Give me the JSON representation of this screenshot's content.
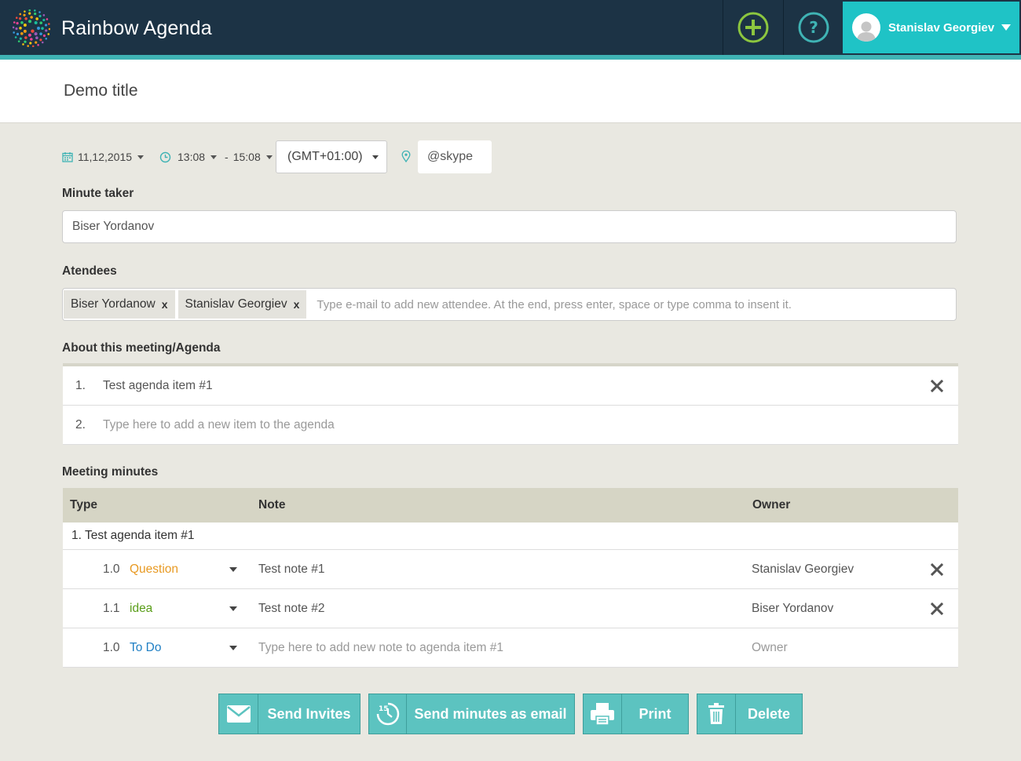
{
  "header": {
    "app_name": "Rainbow Agenda",
    "user_name": "Stanislav Georgiev"
  },
  "page": {
    "title": "Demo title"
  },
  "meta": {
    "date": "11,12,2015",
    "time_start": "13:08",
    "time_sep": "-",
    "time_end": "15:08",
    "timezone": "(GMT+01:00)",
    "location": "@skype"
  },
  "minute_taker": {
    "label": "Minute taker",
    "value": "Biser Yordanov"
  },
  "attendees": {
    "label": "Atendees",
    "chips": [
      "Biser Yordanow",
      "Stanislav Georgiev"
    ],
    "remove_glyph": "x",
    "placeholder": "Type e-mail to add new attendee. At the end, press enter, space or type comma to insent it."
  },
  "agenda": {
    "label": "About this meeting/Agenda",
    "items": [
      {
        "num": "1.",
        "text": "Test agenda item #1"
      }
    ],
    "new_item": {
      "num": "2.",
      "placeholder": "Type here to add a new item to the agenda"
    }
  },
  "minutes": {
    "label": "Meeting minutes",
    "columns": {
      "type": "Type",
      "note": "Note",
      "owner": "Owner"
    },
    "group_title": "1. Test agenda item #1",
    "rows": [
      {
        "num": "1.0",
        "type": "Question",
        "type_color": "#e89a23",
        "note": "Test note #1",
        "owner": "Stanislav Georgiev"
      },
      {
        "num": "1.1",
        "type": "idea",
        "type_color": "#5a9e1a",
        "note": "Test note #2",
        "owner": "Biser Yordanov"
      }
    ],
    "new_row": {
      "num": "1.0",
      "type": "To Do",
      "type_color": "#1f7fc4",
      "note_placeholder": "Type here to add new note to agenda item #1",
      "owner_placeholder": "Owner"
    }
  },
  "actions": {
    "send_invites": "Send Invites",
    "send_minutes": "Send minutes as email",
    "print": "Print",
    "delete": "Delete"
  },
  "colors": {
    "header_bg": "#1c3345",
    "accent": "#3fb3b4",
    "user_menu_bg": "#1fc3c6",
    "add_icon": "#8cc63f",
    "help_icon": "#3fb3b4",
    "button_bg": "#5cc3c0"
  }
}
